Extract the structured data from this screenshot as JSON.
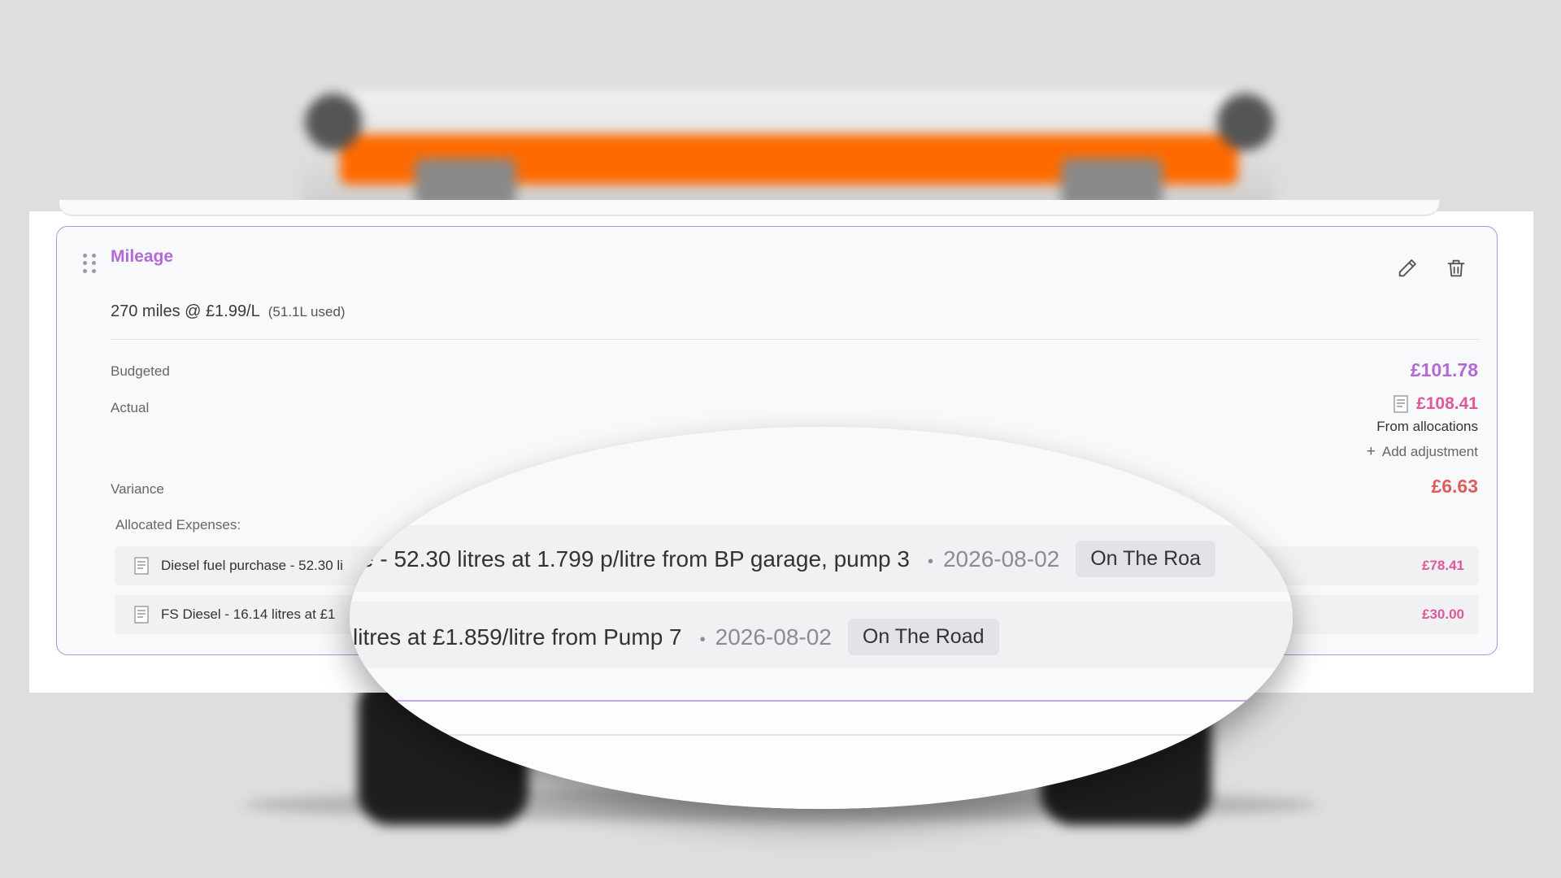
{
  "card": {
    "title": "Mileage",
    "mileage_summary": "270 miles @ £1.99/L",
    "fuel_used": "(51.1L used)"
  },
  "rows": {
    "budgeted_label": "Budgeted",
    "budgeted_value": "£101.78",
    "actual_label": "Actual",
    "actual_value": "£108.41",
    "actual_source": "From allocations",
    "add_adjustment": "Add adjustment",
    "variance_label": "Variance",
    "variance_value": "£6.63"
  },
  "allocated": {
    "heading": "Allocated Expenses:",
    "expenses": [
      {
        "description": "Diesel fuel purchase - 52.30 li",
        "amount": "£78.41"
      },
      {
        "description": "FS Diesel - 16.14 litres at £1",
        "amount": "£30.00"
      }
    ]
  },
  "magnifier": {
    "row1": {
      "text": "e - 52.30 litres at 1.799 p/litre from BP garage, pump 3",
      "date": "2026-08-02",
      "tag": "On The Roa"
    },
    "row2": {
      "text": "litres at £1.859/litre from Pump 7",
      "date": "2026-08-02",
      "tag": "On The Road"
    }
  },
  "colors": {
    "accent_purple": "#b36ad8",
    "amount_pink": "#e0579c",
    "variance_red": "#e05c5c",
    "case_orange": "#ff6a00"
  },
  "icons": [
    "drag-handle-icon",
    "pencil-icon",
    "trash-icon",
    "receipt-icon",
    "plus-icon"
  ]
}
